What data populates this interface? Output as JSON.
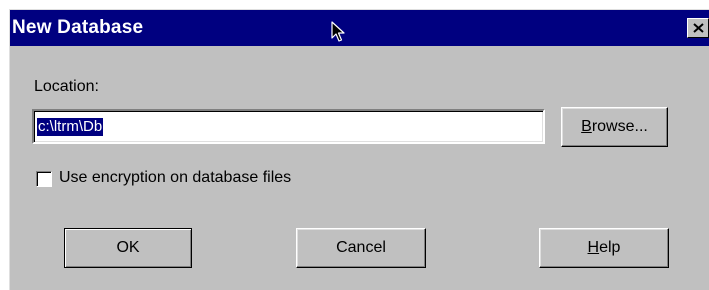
{
  "window": {
    "title": "New Database",
    "close_symbol": "×"
  },
  "location": {
    "label": "Location:",
    "value": "c:\\ltrm\\Db",
    "selected": true
  },
  "browse_button": {
    "label_mnemonic": "B",
    "label_rest": "rowse..."
  },
  "encryption": {
    "label": "Use encryption on database files",
    "checked": false
  },
  "buttons": {
    "ok": "OK",
    "cancel": "Cancel",
    "help_mnemonic": "H",
    "help_rest": "elp"
  },
  "colors": {
    "title_bar": "#000080",
    "face": "#c0c0c0",
    "selection": "#000080"
  },
  "icons": {
    "close": "close-icon",
    "pointer": "mouse-pointer-icon"
  }
}
